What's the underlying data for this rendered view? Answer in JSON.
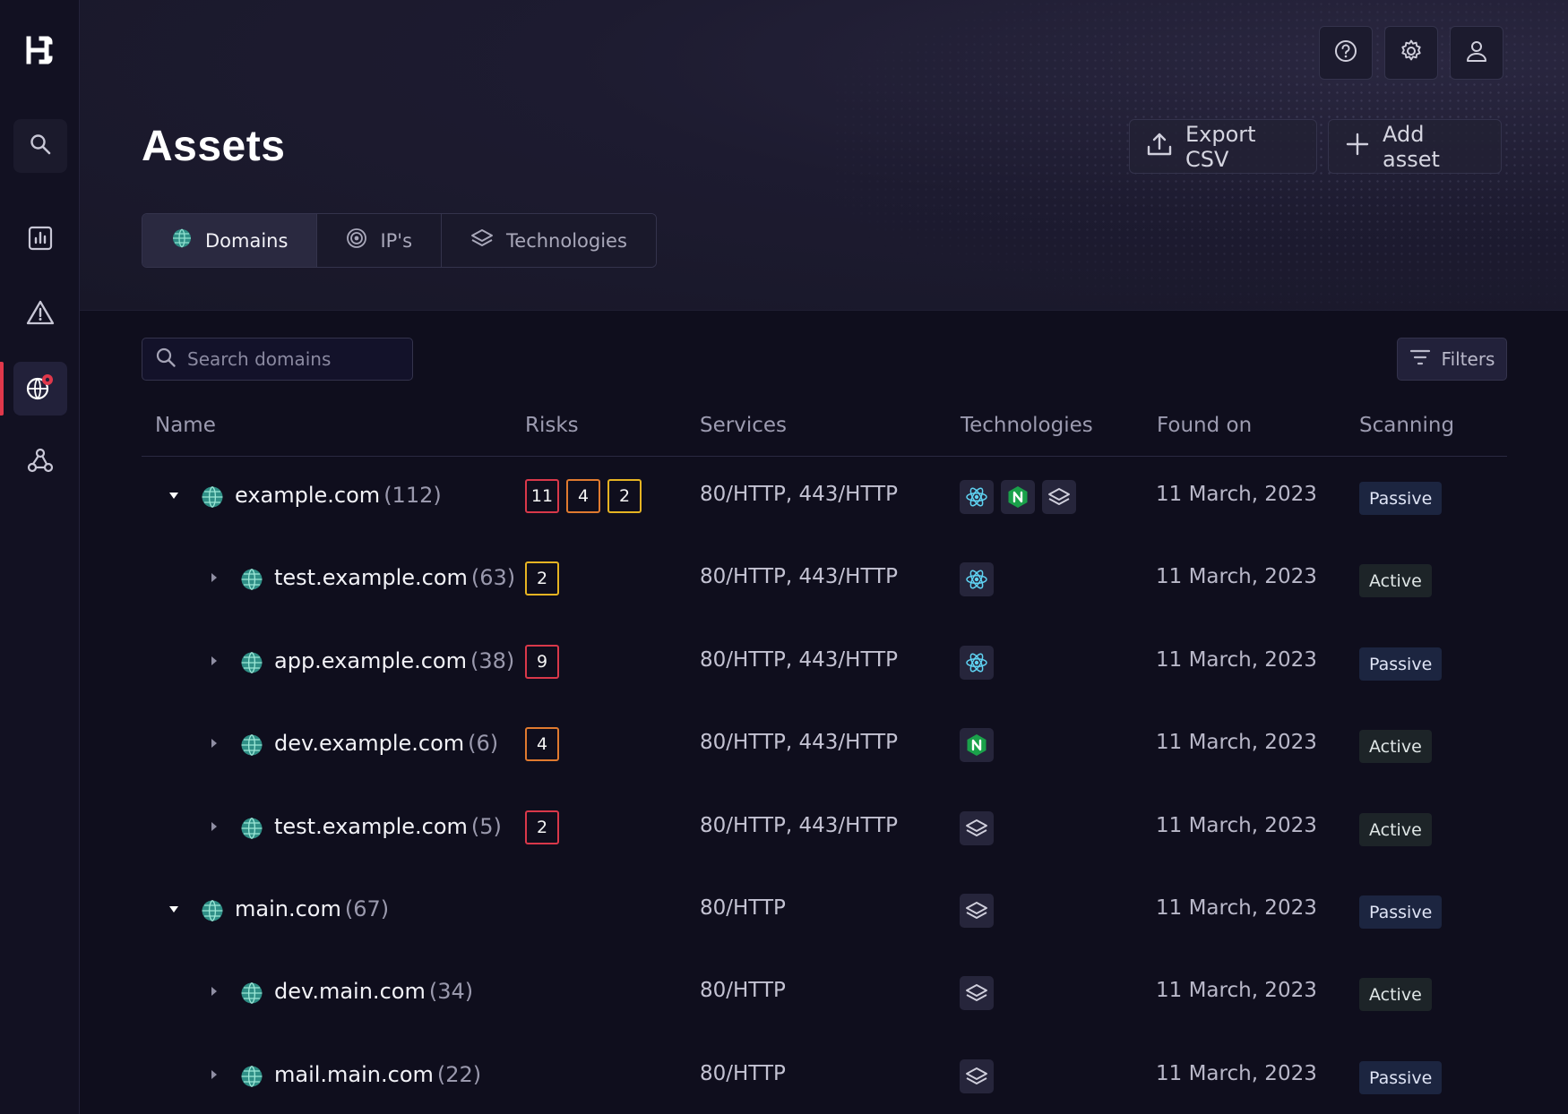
{
  "app": {
    "logo_text": "H"
  },
  "sidebar": {
    "items": [
      {
        "name": "search",
        "icon": "search-icon"
      },
      {
        "name": "analytics",
        "icon": "bar-chart-icon"
      },
      {
        "name": "risks",
        "icon": "warning-icon"
      },
      {
        "name": "assets",
        "icon": "globe-pin-icon",
        "active": true
      },
      {
        "name": "integrations",
        "icon": "webhook-icon"
      }
    ]
  },
  "header": {
    "title": "Assets",
    "help_icon": "help-icon",
    "settings_icon": "gear-icon",
    "user_icon": "user-icon",
    "export_label": "Export CSV",
    "add_label": "Add asset"
  },
  "tabs": [
    {
      "label": "Domains",
      "icon": "globe-icon",
      "active": true
    },
    {
      "label": "IP's",
      "icon": "target-icon",
      "active": false
    },
    {
      "label": "Technologies",
      "icon": "layers-icon",
      "active": false
    }
  ],
  "search": {
    "placeholder": "Search domains",
    "value": ""
  },
  "filters": {
    "label": "Filters"
  },
  "table": {
    "columns": [
      "Name",
      "Risks",
      "Services",
      "Technologies",
      "Found on",
      "Scanning"
    ],
    "rows": [
      {
        "name": "example.com",
        "count": "(112)",
        "level": 0,
        "expanded": true,
        "risks": [
          {
            "value": "11",
            "color": "#d9384a"
          },
          {
            "value": "4",
            "color": "#e07a2f"
          },
          {
            "value": "2",
            "color": "#e6b422"
          }
        ],
        "services": "80/HTTP, 443/HTTP",
        "techs": [
          "react-icon",
          "nginx-icon",
          "layers-icon"
        ],
        "found": "11 March, 2023",
        "scanning": "Passive"
      },
      {
        "name": "test.example.com",
        "count": "(63)",
        "level": 1,
        "expanded": false,
        "risks": [
          {
            "value": "2",
            "color": "#e6b422"
          }
        ],
        "services": "80/HTTP, 443/HTTP",
        "techs": [
          "react-icon"
        ],
        "found": "11 March, 2023",
        "scanning": "Active"
      },
      {
        "name": "app.example.com",
        "count": "(38)",
        "level": 1,
        "expanded": false,
        "risks": [
          {
            "value": "9",
            "color": "#d9384a"
          }
        ],
        "services": "80/HTTP, 443/HTTP",
        "techs": [
          "react-icon"
        ],
        "found": "11 March, 2023",
        "scanning": "Passive"
      },
      {
        "name": "dev.example.com",
        "count": "(6)",
        "level": 1,
        "expanded": false,
        "risks": [
          {
            "value": "4",
            "color": "#e07a2f"
          }
        ],
        "services": "80/HTTP, 443/HTTP",
        "techs": [
          "nginx-icon"
        ],
        "found": "11 March, 2023",
        "scanning": "Active"
      },
      {
        "name": "test.example.com",
        "count": "(5)",
        "level": 1,
        "expanded": false,
        "risks": [
          {
            "value": "2",
            "color": "#d9384a"
          }
        ],
        "services": "80/HTTP, 443/HTTP",
        "techs": [
          "layers-icon"
        ],
        "found": "11 March, 2023",
        "scanning": "Active"
      },
      {
        "name": "main.com",
        "count": "(67)",
        "level": 0,
        "expanded": true,
        "risks": [],
        "services": "80/HTTP",
        "techs": [
          "layers-icon"
        ],
        "found": "11 March, 2023",
        "scanning": "Passive"
      },
      {
        "name": "dev.main.com",
        "count": "(34)",
        "level": 1,
        "expanded": false,
        "risks": [],
        "services": "80/HTTP",
        "techs": [
          "layers-icon"
        ],
        "found": "11 March, 2023",
        "scanning": "Active"
      },
      {
        "name": "mail.main.com",
        "count": "(22)",
        "level": 1,
        "expanded": false,
        "risks": [],
        "services": "80/HTTP",
        "techs": [
          "layers-icon"
        ],
        "found": "11 March, 2023",
        "scanning": "Passive"
      }
    ]
  },
  "colors": {
    "risk_red": "#d9384a",
    "risk_orange": "#e07a2f",
    "risk_yellow": "#e6b422",
    "active_nav": "#e0384b",
    "globe": "#4fb9a8"
  }
}
